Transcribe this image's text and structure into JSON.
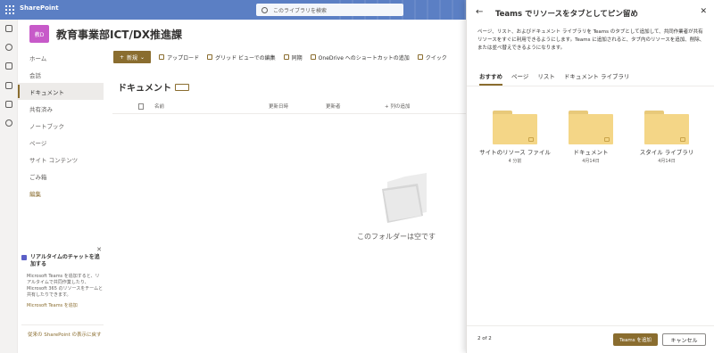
{
  "topbar": {
    "app_name": "SharePoint",
    "search_placeholder": "このライブラリを検索"
  },
  "site": {
    "logo_text": "教D",
    "title": "教育事業部ICT/DX推進課"
  },
  "nav": {
    "items": [
      {
        "label": "ホーム"
      },
      {
        "label": "会話"
      },
      {
        "label": "ドキュメント"
      },
      {
        "label": "共有済み"
      },
      {
        "label": "ノートブック"
      },
      {
        "label": "ページ"
      },
      {
        "label": "サイト コンテンツ"
      },
      {
        "label": "ごみ箱"
      },
      {
        "label": "編集"
      }
    ]
  },
  "chat": {
    "title": "リアルタイムのチャットを追加する",
    "description": "Microsoft Teams を追加すると、リアルタイムで共同作業したり、Microsoft 365 のリソースをチームと共有したりできます。",
    "link": "Microsoft Teams を追加",
    "classic_link": "従来の SharePoint の表示に戻す"
  },
  "commands": {
    "new": "新規",
    "upload": "アップロード",
    "grid_edit": "グリッド ビューでの編集",
    "sync": "同期",
    "onedrive_shortcut": "OneDrive へのショートカットの追加",
    "quick": "クイック"
  },
  "library": {
    "title": "ドキュメント",
    "columns": {
      "name": "名前",
      "modified": "更新日時",
      "modified_by": "更新者",
      "add_column": "+ 列の追加"
    },
    "empty_message": "このフォルダーは空です"
  },
  "panel": {
    "title": "Teams でリソースをタブとしてピン留め",
    "description": "ページ、リスト、およびドキュメント ライブラリを Teams のタブとして追加して、共同作業者が共有リソースをすぐに利用できるようにします。Teams に追加されると、タブ内のリソースを追加、削除、または並べ替えできるようになります。",
    "tabs": [
      {
        "label": "おすすめ"
      },
      {
        "label": "ページ"
      },
      {
        "label": "リスト"
      },
      {
        "label": "ドキュメント ライブラリ"
      }
    ],
    "folders": [
      {
        "name": "サイトのリソース ファイル",
        "meta": "4 分前"
      },
      {
        "name": "ドキュメント",
        "meta": "4月14日"
      },
      {
        "name": "スタイル ライブラリ",
        "meta": "4月14日"
      }
    ],
    "pager": "2 of 2",
    "add_button": "Teams を追加",
    "cancel_button": "キャンセル"
  },
  "colors": {
    "accent": "#8a6d2f",
    "topbar": "#5b7fc4",
    "folder": "#f4d687",
    "logo": "#c75ac9"
  }
}
